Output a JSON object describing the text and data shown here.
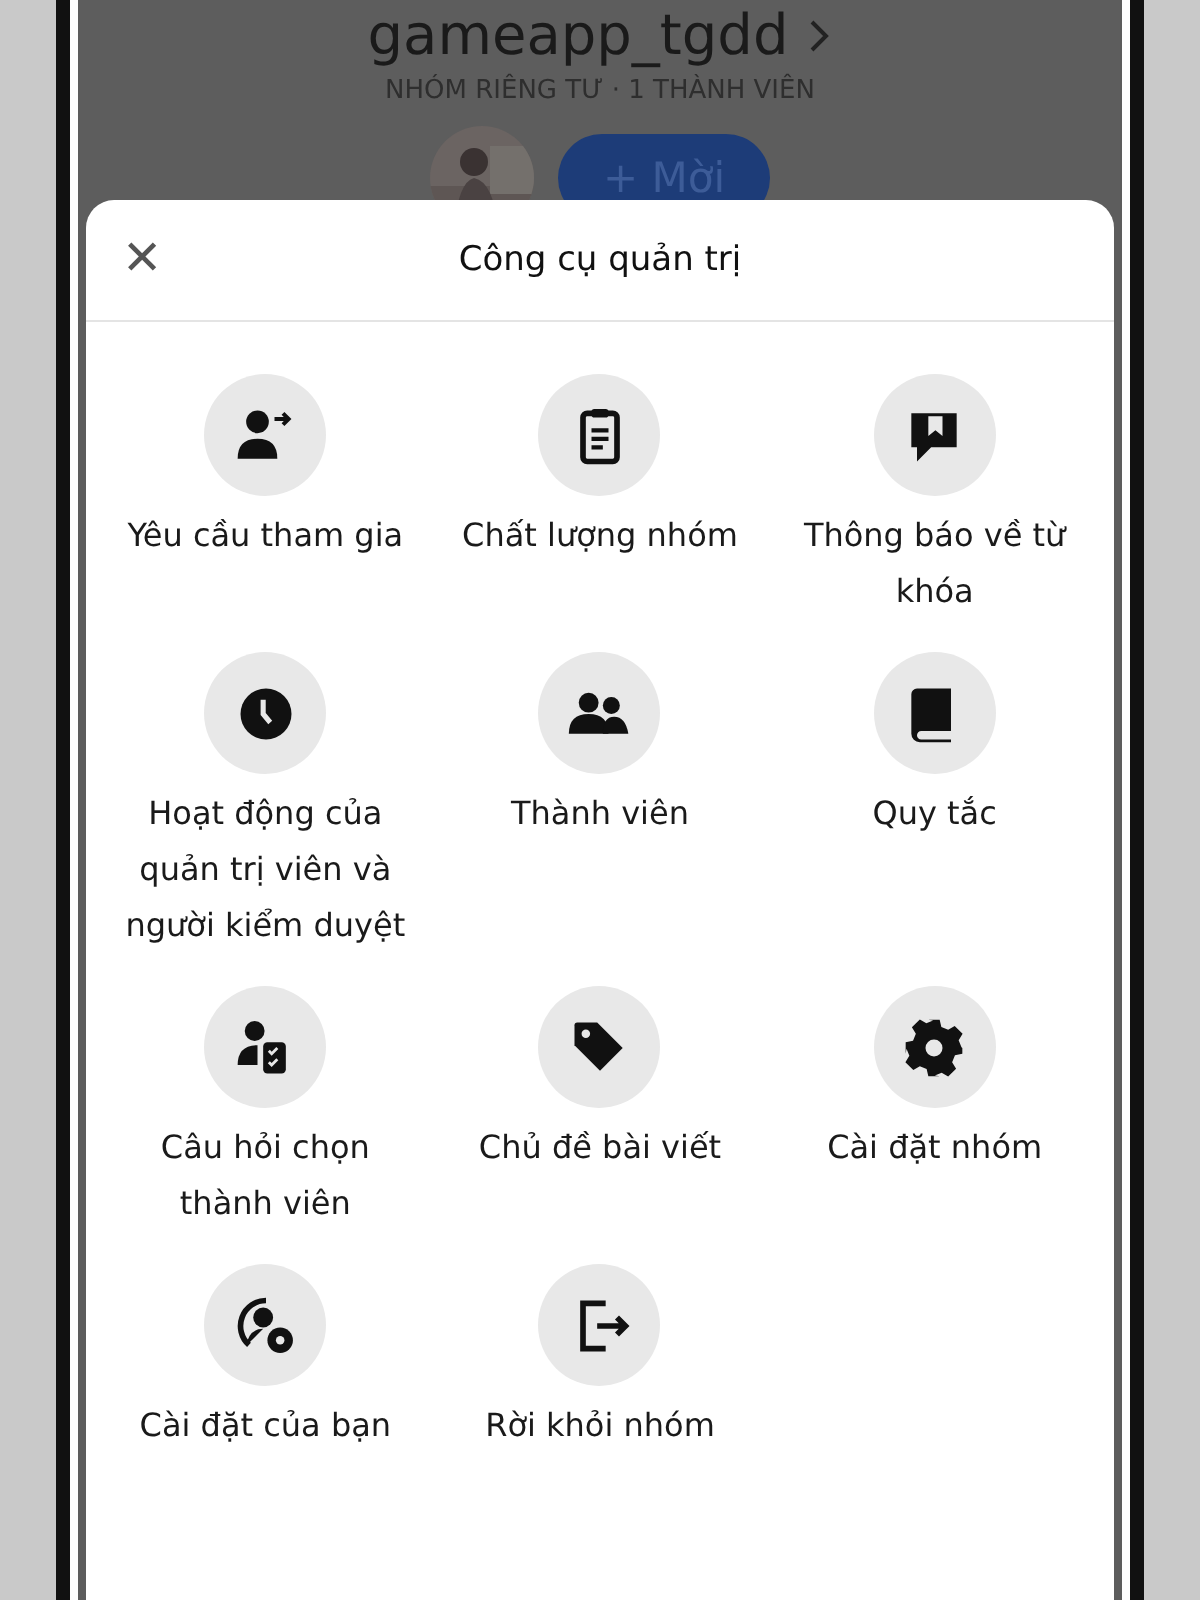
{
  "group": {
    "name": "gameapp_tgdd",
    "subtitle": "NHÓM RIÊNG TƯ · 1 THÀNH VIÊN",
    "invite_button": "+ Mời"
  },
  "sheet": {
    "title": "Công cụ quản trị",
    "close_icon": "✕",
    "tools": [
      {
        "label": "Yêu cầu tham gia"
      },
      {
        "label": "Chất lượng nhóm"
      },
      {
        "label": "Thông báo về từ khóa"
      },
      {
        "label": "Hoạt động của quản trị viên và người kiểm duyệt"
      },
      {
        "label": "Thành viên"
      },
      {
        "label": "Quy tắc"
      },
      {
        "label": "Câu hỏi chọn thành viên"
      },
      {
        "label": "Chủ đề bài viết"
      },
      {
        "label": "Cài đặt nhóm"
      },
      {
        "label": "Cài đặt của bạn"
      },
      {
        "label": "Rời khỏi nhóm"
      }
    ]
  }
}
